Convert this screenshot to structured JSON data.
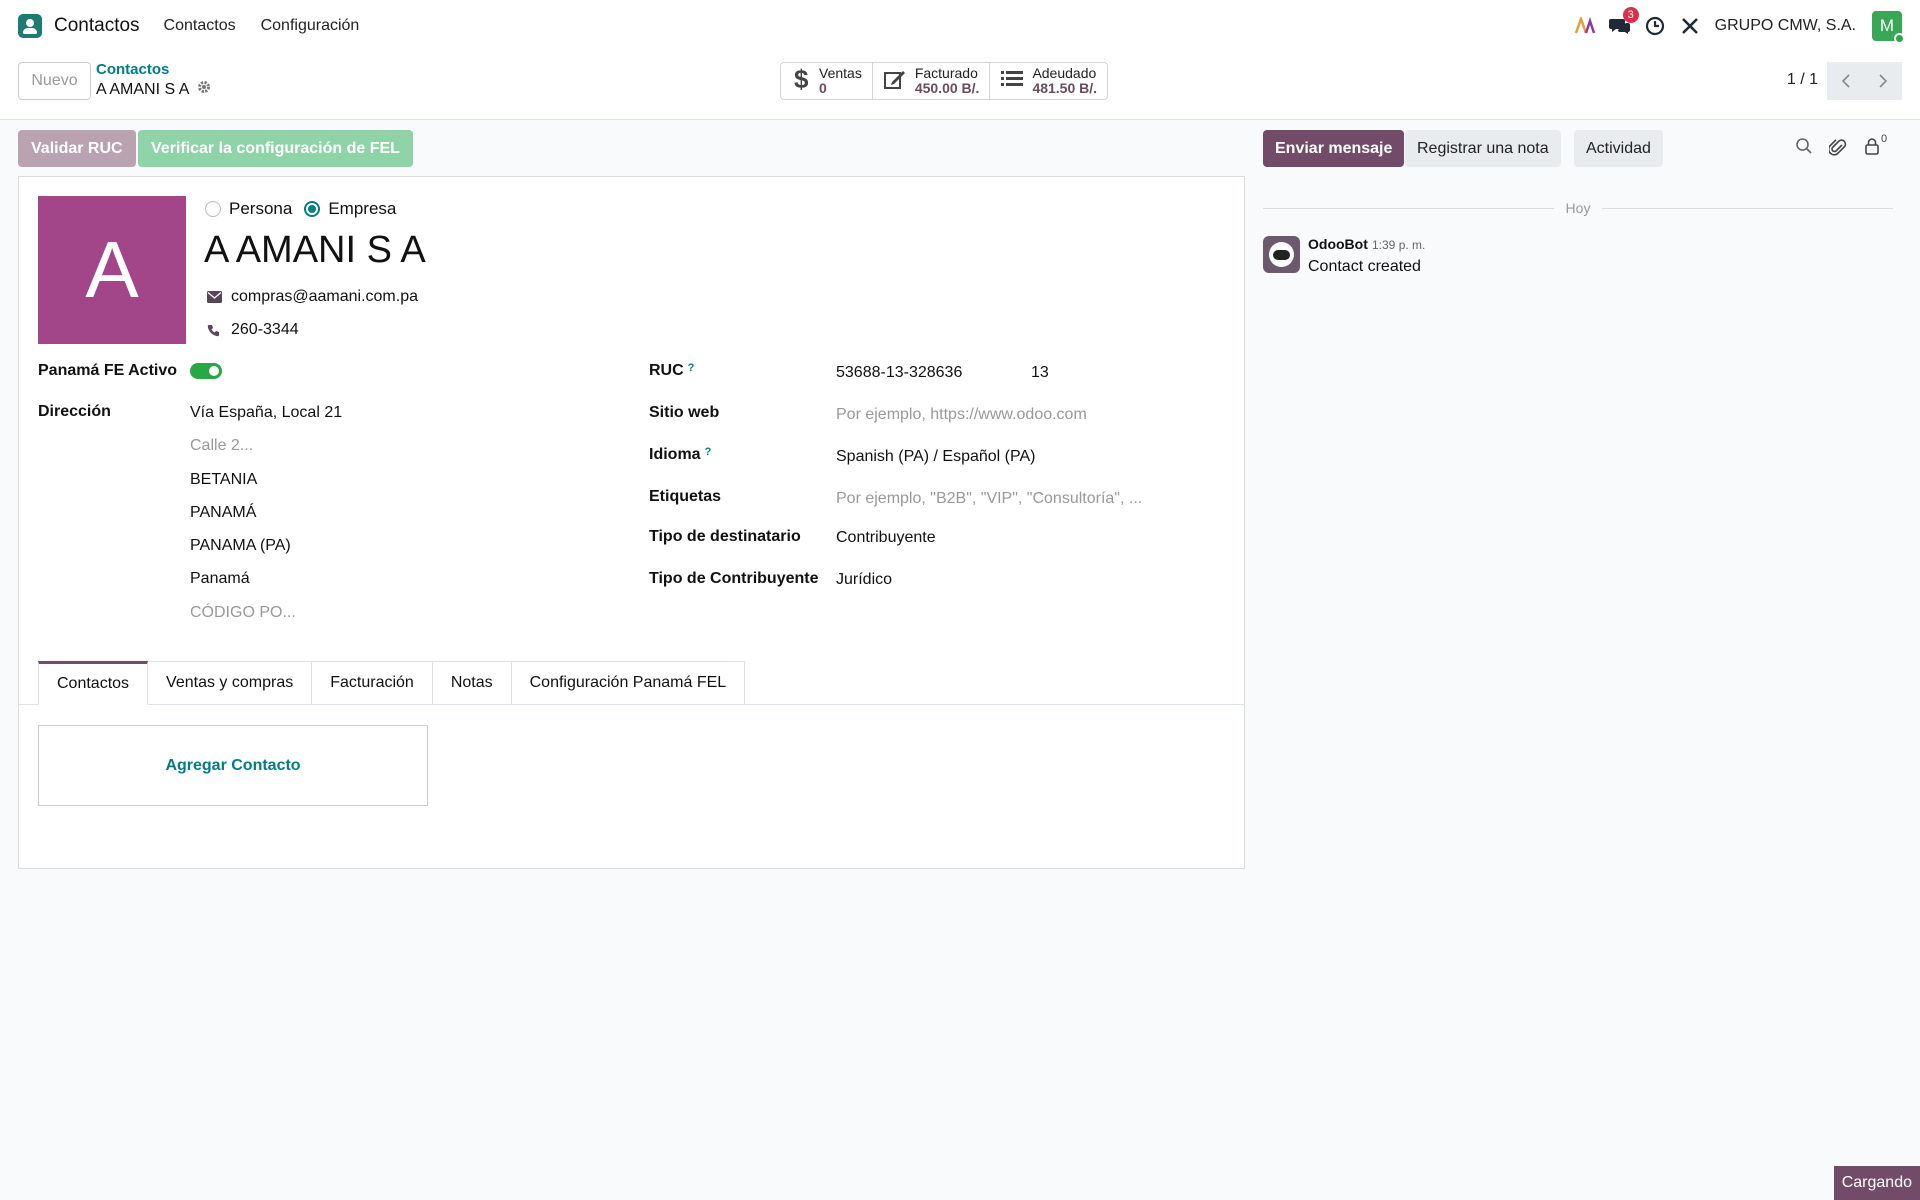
{
  "navbar": {
    "app_name": "Contactos",
    "menu": [
      "Contactos",
      "Configuración"
    ],
    "messages_badge": "3",
    "company": "GRUPO CMW, S.A.",
    "user_initial": "M"
  },
  "control": {
    "new_label": "Nuevo",
    "breadcrumb_parent": "Contactos",
    "breadcrumb_current": "A AMANI S A",
    "stats": [
      {
        "label": "Ventas",
        "value": "0"
      },
      {
        "label": "Facturado",
        "value": "450.00 B/."
      },
      {
        "label": "Adeudado",
        "value": "481.50 B/."
      }
    ],
    "pager": "1 / 1"
  },
  "actions": {
    "validar_ruc": "Validar RUC",
    "verificar_fel": "Verificar la configuración de FEL"
  },
  "form": {
    "avatar_letter": "A",
    "type_options": [
      "Persona",
      "Empresa"
    ],
    "selected_type": "Empresa",
    "name": "A AMANI S A",
    "email": "compras@aamani.com.pa",
    "phone": "260-3344",
    "fe_activo_label": "Panamá FE Activo",
    "fe_activo": true,
    "address_label": "Dirección",
    "address": {
      "street": "Vía España, Local 21",
      "street2_placeholder": "Calle 2...",
      "line3": "BETANIA",
      "line4": "PANAMÁ",
      "state": "PANAMA (PA)",
      "country": "Panamá",
      "zip_placeholder": "CÓDIGO PO..."
    },
    "ruc_label": "RUC",
    "ruc": "53688-13-328636",
    "dv": "13",
    "website_label": "Sitio web",
    "website_placeholder": "Por ejemplo, https://www.odoo.com",
    "lang_label": "Idioma",
    "lang": "Spanish (PA) / Español (PA)",
    "tags_label": "Etiquetas",
    "tags_placeholder": "Por ejemplo, \"B2B\", \"VIP\", \"Consultoría\", ...",
    "recipient_type_label": "Tipo de destinatario",
    "recipient_type": "Contribuyente",
    "taxpayer_type_label": "Tipo de Contribuyente",
    "taxpayer_type": "Jurídico",
    "help_mark": "?",
    "tabs": [
      "Contactos",
      "Ventas y compras",
      "Facturación",
      "Notas",
      "Configuración Panamá FEL"
    ],
    "active_tab": "Contactos",
    "add_contact": "Agregar Contacto"
  },
  "chatter": {
    "send_message": "Enviar mensaje",
    "log_note": "Registrar una nota",
    "activity": "Actividad",
    "followers_count": "0",
    "today": "Hoy",
    "message": {
      "author": "OdooBot",
      "time": "1:39 p. m.",
      "body": "Contact created"
    }
  },
  "status": {
    "loading": "Cargando"
  },
  "colors": {
    "brand": "#714b67",
    "accent": "#017e84",
    "avatar": "#a24689",
    "success": "#28a745",
    "badge": "#d9304c"
  }
}
